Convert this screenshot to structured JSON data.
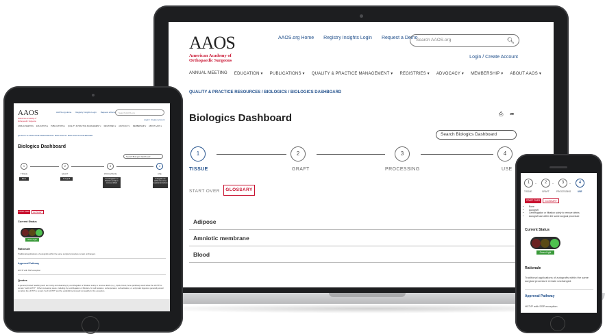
{
  "site": {
    "logo_mark": "AAOS",
    "logo_sub_line1": "American Academy of",
    "logo_sub_line2": "Orthopaedic Surgeons",
    "top_links": [
      "AAOS.org Home",
      "Registry Insights Login",
      "Request a Demo"
    ],
    "search_placeholder": "Search AAOS.org",
    "login_label": "Login / Create Account",
    "nav": [
      "ANNUAL MEETING",
      "EDUCATION ▾",
      "PUBLICATIONS ▾",
      "QUALITY & PRACTICE MANAGEMENT ▾",
      "REGISTRIES ▾",
      "ADVOCACY ▾",
      "MEMBERSHIP ▾",
      "ABOUT AAOS ▾"
    ],
    "breadcrumb": "QUALITY & PRACTICE RESOURCES / BIOLOGICS / BIOLOGICS DASHBOARD",
    "page_title": "Biologics Dashboard",
    "dashboard_search_placeholder": "Search Biologics Dashboard",
    "steps": [
      {
        "num": "1",
        "label": "TISSUE"
      },
      {
        "num": "2",
        "label": "GRAFT"
      },
      {
        "num": "3",
        "label": "PROCESSING"
      },
      {
        "num": "4",
        "label": "USE"
      }
    ],
    "start_over": "START OVER",
    "glossary": "GLOSSARY",
    "tissues": [
      "Adipose",
      "Amniotic membrane",
      "Blood"
    ]
  },
  "tablet": {
    "chips": [
      "Bone",
      "Autograft",
      "Centrifugation or filtration solely to remove debris",
      "Autograft use within the same surgical procedure"
    ],
    "current_status": "Current Status",
    "status_light": "Green Light",
    "rationale": "Rationale",
    "rationale_text": "Traditional applications of autografts within the same surgical procedure remain unchanged.",
    "approval_pathway": "Approval Pathway",
    "approval_text": "HCT/P with SSP exception",
    "quotes": "Quotes",
    "quotes_text": "In general, limited handling such as rinsing and cleansing by centrifugation or filtration solely to remove debris (e.g., lipids, blood, bone particles) would allow the HCT/P to remain \"such HCT/P\". Other processing steps, including by centrifugation or filtration, for cell isolation, cell expansion, cell activation, or enzymatic digestion generally would not allow the HCT/P to remain \"such HCT/P\" and the establishment would not qualify for the exception."
  },
  "phone": {
    "steps": [
      "1",
      "2",
      "3",
      "4"
    ],
    "step_labels": [
      "TISSUE",
      "GRAFT",
      "PROCESSING",
      "USE"
    ],
    "bullets": [
      "Bone",
      "Autograft",
      "Centrifugation or filtration solely to remove debris",
      "Autograft use within the same surgical procedure"
    ],
    "current_status": "Current Status",
    "status_light": "Green Light",
    "rationale": "Rationale",
    "rationale_text": "Traditional applications of autografts within the same surgical procedure remain unchanged.",
    "approval_pathway": "Approval Pathway",
    "approval_text": "HCT/P with SSP exception"
  },
  "colors": {
    "brand_red": "#c8102e",
    "link_blue": "#1f4e8a",
    "light_red": "#6b2222",
    "light_amber": "#5a4a16",
    "light_green": "#4fc14f"
  },
  "icons": [
    "search-icon",
    "print-icon",
    "share-icon"
  ]
}
